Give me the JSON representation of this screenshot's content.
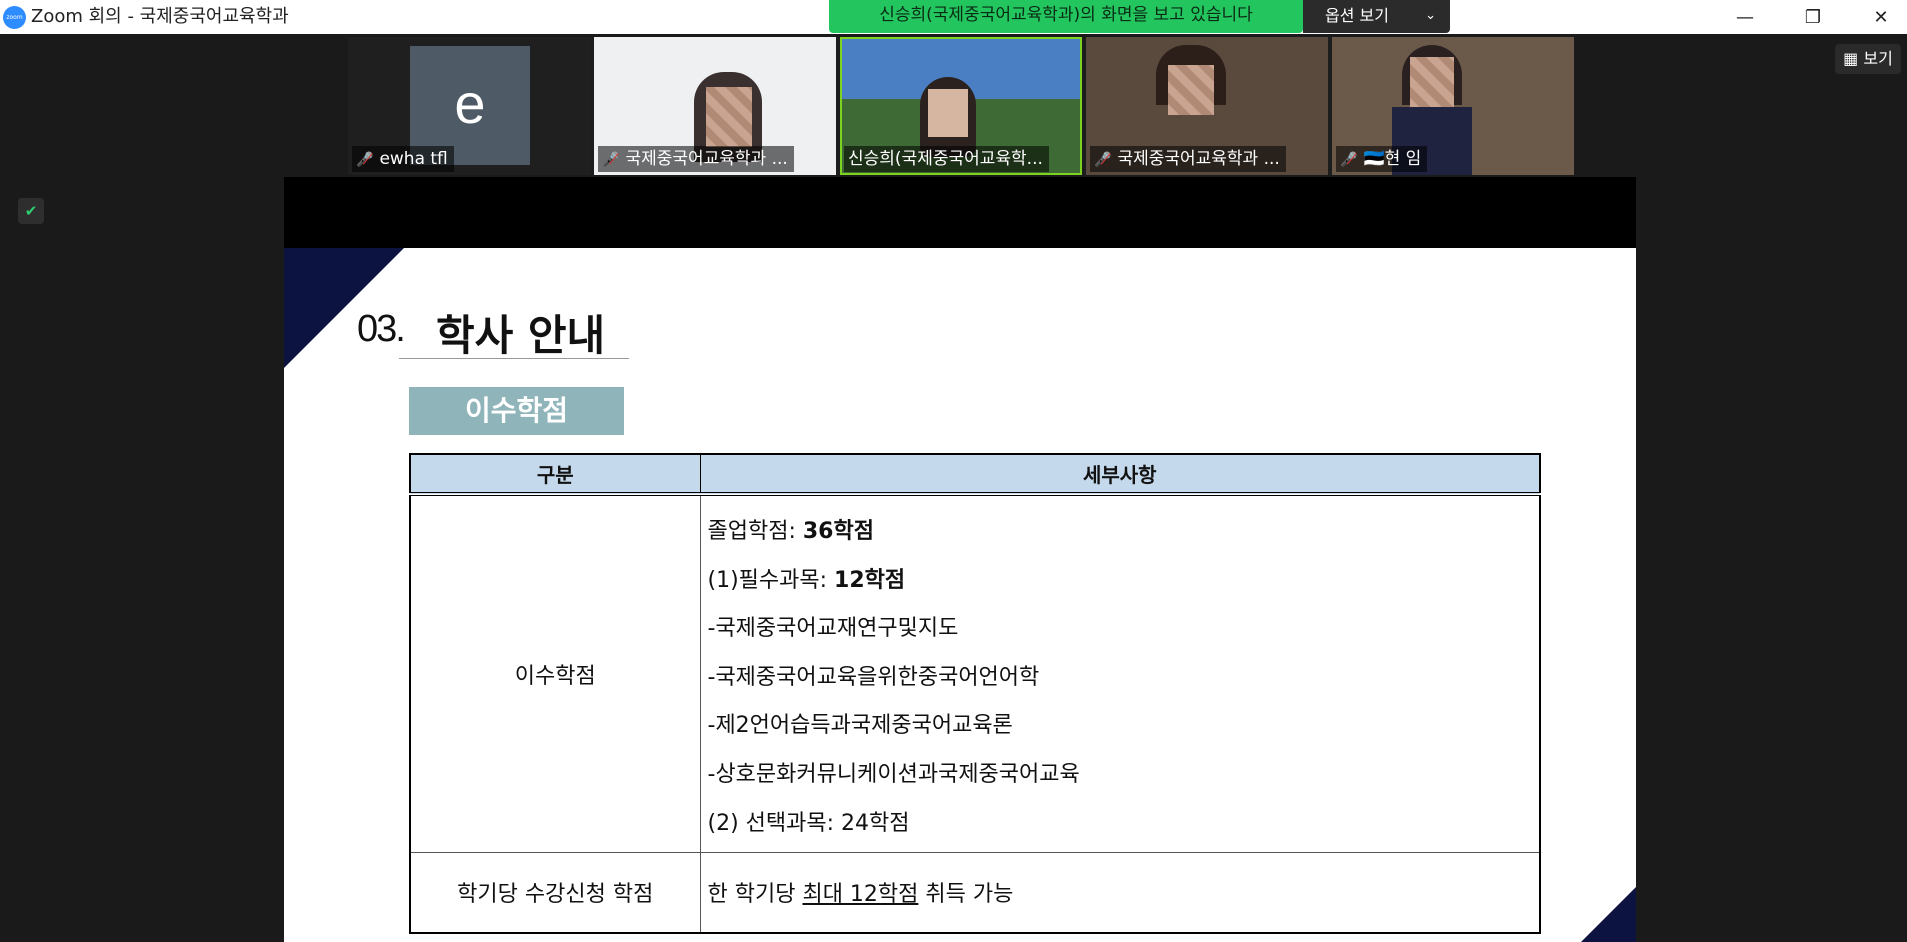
{
  "window": {
    "logo_text": "zoom",
    "title": "Zoom 회의 - 국제중국어교육학과",
    "controls": {
      "minimize": "—",
      "maximize": "❐",
      "close": "✕"
    }
  },
  "banner": {
    "sharing_text": "신승희(국제중국어교육학과)의 화면을 보고 있습니다",
    "view_options_label": "옵션 보기",
    "view_options_chevron": "⌄"
  },
  "colors": {
    "banner": "#22c55e",
    "active_speaker": "#7ed321",
    "slide_accent": "#0d1340",
    "table_header": "#c5d9ec",
    "tag_bg": "#8fb5ba"
  },
  "gallery": {
    "participants": [
      {
        "name": "ewha tfl",
        "avatar_letter": "e",
        "muted": true
      },
      {
        "name": "국제중국어교육학과 ...",
        "muted": true
      },
      {
        "name": "신승희(국제중국어교육학...",
        "muted": false,
        "active": true
      },
      {
        "name": "국제중국어교육학과 ...",
        "muted": true
      },
      {
        "name": "🇪🇪현 임",
        "muted": true
      }
    ],
    "mic_icon": "muted-mic-icon"
  },
  "view_button": {
    "label": "보기",
    "icon": "grid-icon"
  },
  "security_icon": "shield-check-icon",
  "slide": {
    "section_number": "03.",
    "section_title": "학사 안내",
    "tag": "이수학점",
    "table": {
      "headers": [
        "구분",
        "세부사항"
      ],
      "rows": [
        {
          "category": "이수학점",
          "lines": [
            {
              "text": "졸업학점: ",
              "bold": "36학점"
            },
            {
              "text": "(1)필수과목: ",
              "bold": "12학점"
            },
            {
              "text": "-국제중국어교재연구및지도"
            },
            {
              "text": "-국제중국어교육을위한중국어언어학"
            },
            {
              "text": "-제2언어습득과국제중국어교육론"
            },
            {
              "text": "-상호문화커뮤니케이션과국제중국어교육"
            },
            {
              "text": "(2) 선택과목: 24학점"
            }
          ]
        },
        {
          "category": "학기당 수강신청 학점",
          "prefix": "한 학기당 ",
          "emphasis": "최대 12학점",
          "suffix": " 취득 가능"
        }
      ]
    }
  }
}
